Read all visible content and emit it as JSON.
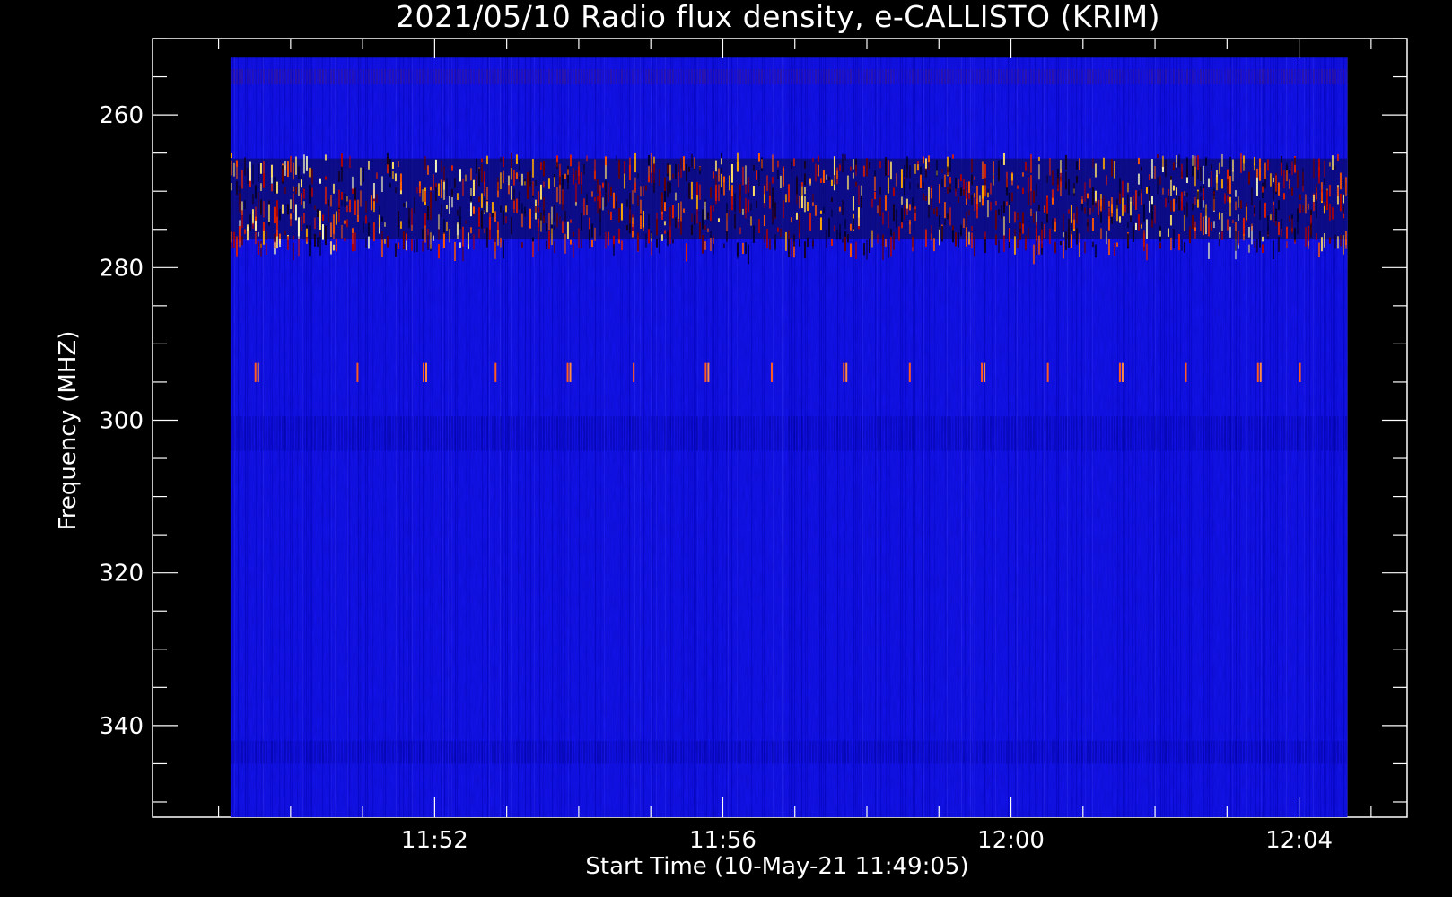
{
  "chart_data": {
    "type": "heatmap",
    "title": "2021/05/10  Radio flux density, e-CALLISTO (KRIM)",
    "xlabel": "Start Time (10-May-21 11:49:05)",
    "ylabel": "Frequency (MHZ)",
    "x_axis": {
      "unit": "time",
      "range": [
        "11:48:05",
        "12:05:30"
      ],
      "data_range": [
        "11:49:10",
        "12:04:40"
      ],
      "major_ticks": [
        "11:52",
        "11:56",
        "12:00",
        "12:04"
      ],
      "minor_tick_interval_minutes": 1
    },
    "y_axis": {
      "unit": "MHz",
      "inverted": true,
      "range": [
        250,
        352
      ],
      "data_range": [
        252.5,
        352
      ],
      "major_ticks": [
        260,
        280,
        300,
        320,
        340
      ],
      "minor_tick_interval": 5
    },
    "colormap": [
      "#000030",
      "#0000c8",
      "#1414ff",
      "#b40000",
      "#ff3c00",
      "#ffaa00",
      "#ffff80"
    ],
    "background_color": "#1414f0",
    "bands": [
      {
        "freq_range": [
          265,
          277
        ],
        "intensity": "high"
      },
      {
        "freq_range": [
          254,
          256
        ],
        "intensity": "moderate"
      },
      {
        "freq_range": [
          299.5,
          304
        ],
        "intensity": "low"
      },
      {
        "freq_range": [
          342,
          345
        ],
        "intensity": "low"
      }
    ],
    "high_activity_intervals": [
      [
        "12:01:40",
        "12:03:30"
      ],
      [
        "11:49:10",
        "11:52:30"
      ]
    ],
    "spikes": {
      "freq_range": [
        292.5,
        295
      ],
      "times": [
        "11:49:30",
        "11:50:55",
        "11:51:50",
        "11:52:50",
        "11:53:50",
        "11:54:45",
        "11:55:45",
        "11:56:40",
        "11:57:40",
        "11:58:35",
        "11:59:35",
        "12:00:30",
        "12:01:30",
        "12:02:25",
        "12:03:25",
        "12:04:00"
      ]
    },
    "grid": false,
    "legend": "none"
  }
}
